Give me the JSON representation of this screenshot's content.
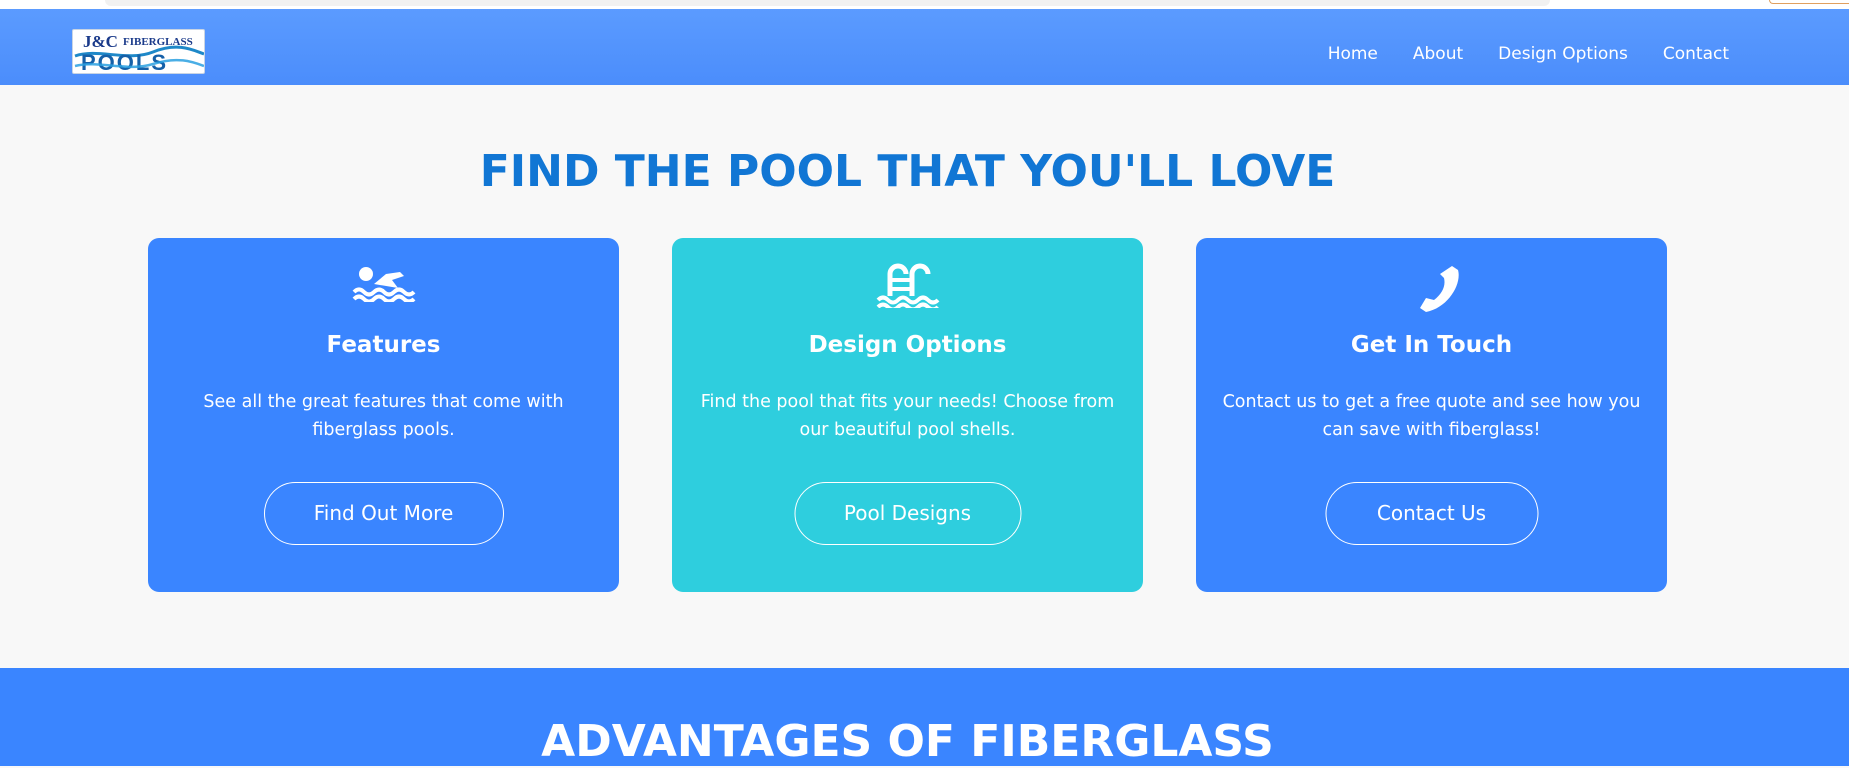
{
  "logo": {
    "line1": "J&C",
    "line2": "FIBERGLASS",
    "line3": "POOLS"
  },
  "nav": {
    "items": [
      {
        "label": "Home"
      },
      {
        "label": "About"
      },
      {
        "label": "Design Options"
      },
      {
        "label": "Contact"
      }
    ]
  },
  "main": {
    "title": "FIND THE POOL THAT YOU'LL LOVE"
  },
  "cards": [
    {
      "icon": "swimmer-icon",
      "title": "Features",
      "description": "See all the great features that come with fiberglass pools.",
      "button": "Find Out More",
      "color": "#3a85ff"
    },
    {
      "icon": "pool-ladder-icon",
      "title": "Design Options",
      "description": "Find the pool that fits your needs! Choose from our beautiful pool shells.",
      "button": "Pool Designs",
      "color": "#2ecede"
    },
    {
      "icon": "phone-icon",
      "title": "Get In Touch",
      "description": "Contact us to get a free quote and see how you can save with fiberglass!",
      "button": "Contact Us",
      "color": "#3a85ff"
    }
  ],
  "advantages": {
    "heading": "ADVANTAGES OF FIBERGLASS"
  },
  "colors": {
    "header": "#4b8dfb",
    "title": "#1176d4",
    "card_blue": "#3a85ff",
    "card_teal": "#2ecede"
  }
}
